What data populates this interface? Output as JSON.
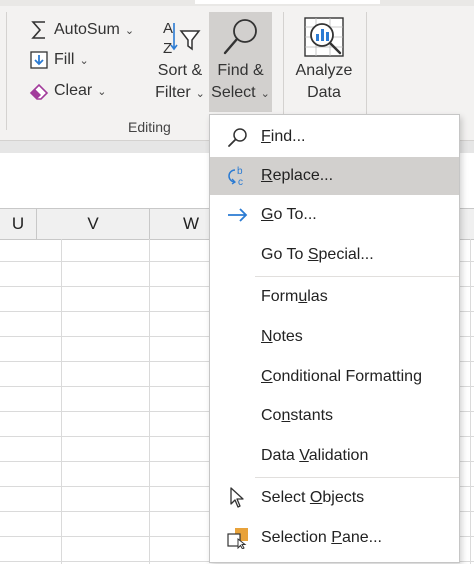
{
  "ribbon": {
    "autosum": {
      "label": "AutoSum",
      "icon": "sigma-icon"
    },
    "fill": {
      "label": "Fill",
      "icon": "fill-down-icon"
    },
    "clear": {
      "label": "Clear",
      "icon": "eraser-icon"
    },
    "sort_filter": {
      "line1": "Sort &",
      "line2": "Filter",
      "icon": "sort-filter-icon"
    },
    "find_select": {
      "line1": "Find &",
      "line2": "Select",
      "icon": "magnifier-icon"
    },
    "analyze": {
      "line1": "Analyze",
      "line2": "Data",
      "icon": "analyze-data-icon"
    },
    "group_label": "Editing"
  },
  "columns": [
    "U",
    "V",
    "W"
  ],
  "menu": {
    "items": [
      {
        "pre": "",
        "u": "F",
        "post": "ind...",
        "icon": "search-icon"
      },
      {
        "pre": "",
        "u": "R",
        "post": "eplace...",
        "icon": "replace-icon",
        "highlighted": true
      },
      {
        "pre": "",
        "u": "G",
        "post": "o To...",
        "icon": "arrow-right-icon"
      },
      {
        "pre": "Go To ",
        "u": "S",
        "post": "pecial...",
        "icon": ""
      },
      {
        "pre": "Form",
        "u": "u",
        "post": "las",
        "icon": ""
      },
      {
        "pre": "",
        "u": "N",
        "post": "otes",
        "icon": ""
      },
      {
        "pre": "",
        "u": "C",
        "post": "onditional Formatting",
        "icon": ""
      },
      {
        "pre": "Co",
        "u": "n",
        "post": "stants",
        "icon": ""
      },
      {
        "pre": "Data ",
        "u": "V",
        "post": "alidation",
        "icon": ""
      },
      {
        "pre": "Select ",
        "u": "O",
        "post": "bjects",
        "icon": "pointer-icon"
      },
      {
        "pre": "Selection ",
        "u": "P",
        "post": "ane...",
        "icon": "selection-pane-icon"
      }
    ]
  },
  "colors": {
    "accent": "#2b7bd3",
    "highlight": "#d2d0ce",
    "eraser": "#a23b9b",
    "pane": "#e8a23a"
  }
}
